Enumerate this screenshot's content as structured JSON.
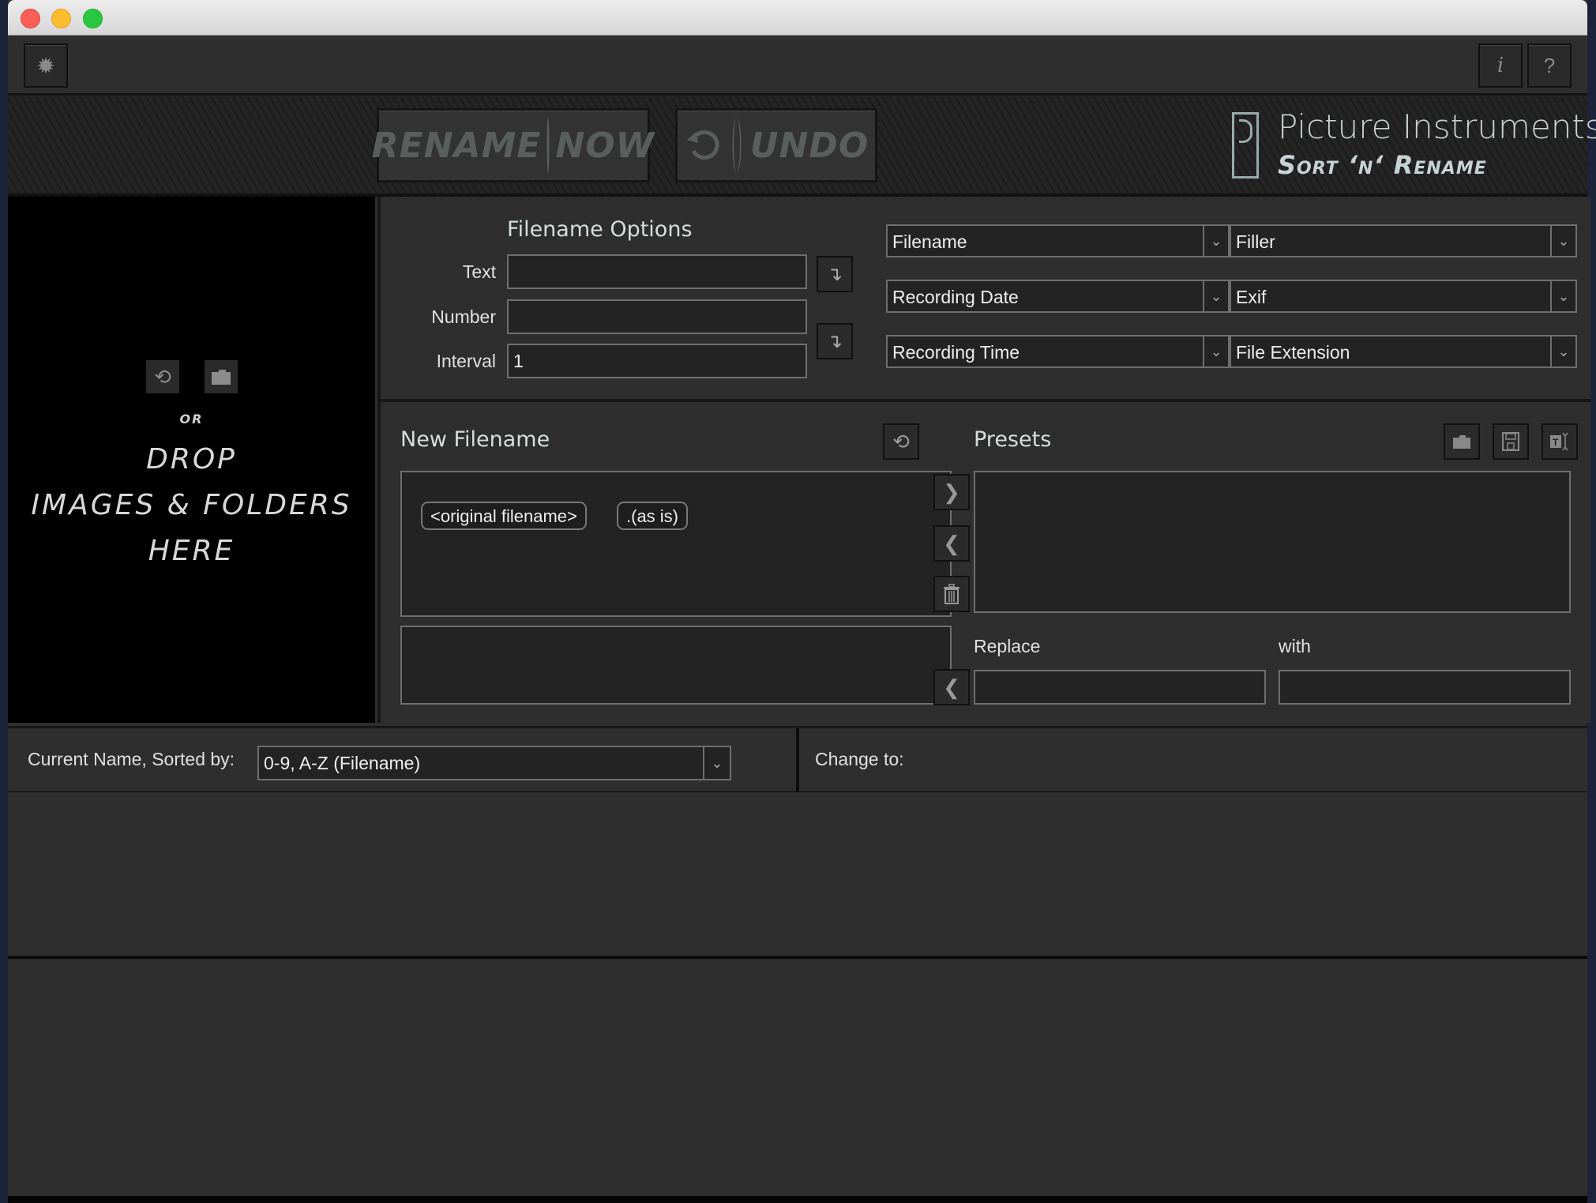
{
  "window": {
    "app_name": "Picture Instruments Sort 'n' Rename"
  },
  "toolbar": {
    "settings_icon": "gear-icon",
    "info_label": "i",
    "help_label": "?"
  },
  "banner": {
    "rename_now": {
      "part1": "RENAME",
      "part2": "NOW"
    },
    "undo": {
      "icon": "undo-icon",
      "label": "UNDO"
    },
    "brand_title": "Picture Instruments",
    "brand_subtitle": "Sort ‘n‘ Rename"
  },
  "drop_panel": {
    "reload_icon": "reload-icon",
    "folder_icon": "folder-icon",
    "or_label": "OR",
    "lines": [
      "DROP",
      "IMAGES & FOLDERS",
      "HERE"
    ]
  },
  "filename_options": {
    "title": "Filename Options",
    "text": {
      "label": "Text",
      "value": ""
    },
    "number": {
      "label": "Number",
      "value": ""
    },
    "interval": {
      "label": "Interval",
      "value": "1"
    },
    "insert_icon": "insert-arrow-icon",
    "selects": [
      {
        "left": "Filename",
        "right": "Filler"
      },
      {
        "left": "Recording Date",
        "right": "Exif"
      },
      {
        "left": "Recording Time",
        "right": "File Extension"
      }
    ]
  },
  "new_filename": {
    "title": "New Filename",
    "tags": [
      "<original filename>",
      ".(as is)"
    ],
    "reset_icon": "reset-icon",
    "add_icon": "chevron-right-icon",
    "remove_icon": "chevron-left-icon",
    "delete_icon": "trash-icon"
  },
  "presets": {
    "title": "Presets",
    "replace_label": "Replace",
    "with_label": "with",
    "replace_value": "",
    "with_value": ""
  },
  "sort_bar": {
    "current_label": "Current Name, Sorted by:",
    "sort_value": "0-9, A-Z (Filename)",
    "change_label": "Change to:"
  }
}
